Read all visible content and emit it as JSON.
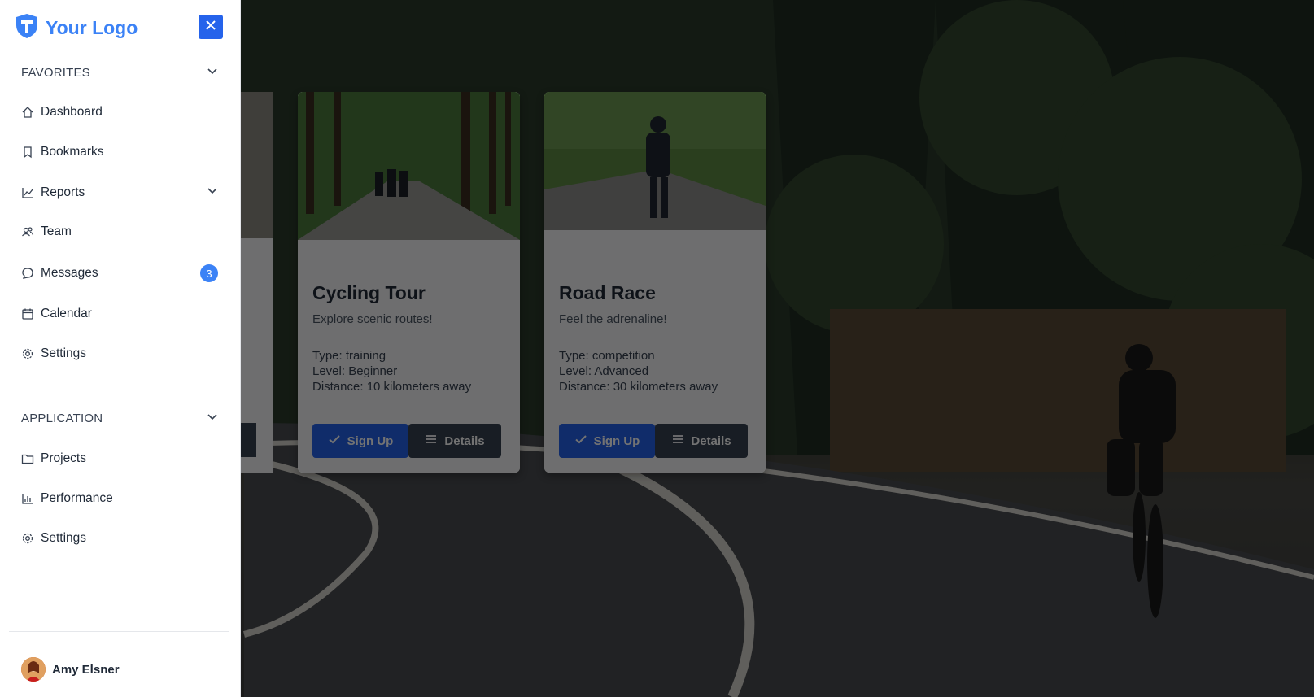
{
  "brand": {
    "logo_text": "Your Logo"
  },
  "sidebar": {
    "favorites_label": "FAVORITES",
    "favorites": [
      {
        "label": "Dashboard",
        "icon": "home-icon"
      },
      {
        "label": "Bookmarks",
        "icon": "bookmark-icon"
      },
      {
        "label": "Reports",
        "icon": "chart-line-icon",
        "expandable": true
      },
      {
        "label": "Team",
        "icon": "team-icon"
      },
      {
        "label": "Messages",
        "icon": "chat-icon",
        "badge": "3"
      },
      {
        "label": "Calendar",
        "icon": "calendar-icon"
      },
      {
        "label": "Settings",
        "icon": "gear-icon"
      }
    ],
    "application_label": "APPLICATION",
    "application": [
      {
        "label": "Projects",
        "icon": "folder-icon"
      },
      {
        "label": "Performance",
        "icon": "bar-chart-icon"
      },
      {
        "label": "Settings",
        "icon": "gear-icon"
      }
    ],
    "user": {
      "name": "Amy Elsner"
    }
  },
  "cards": [
    {
      "title": "Cycling Tour",
      "subtitle": "Explore scenic routes!",
      "type": "Type: training",
      "level": "Level: Beginner",
      "distance": "Distance: 10 kilometers away",
      "primary_label": "Sign Up",
      "secondary_label": "Details"
    },
    {
      "title": "Road Race",
      "subtitle": "Feel the adrenaline!",
      "type": "Type: competition",
      "level": "Level: Advanced",
      "distance": "Distance: 30 kilometers away",
      "primary_label": "Sign Up",
      "secondary_label": "Details"
    }
  ],
  "colors": {
    "accent": "#3b82f6",
    "button_primary": "#2563eb",
    "button_secondary": "#374151",
    "overlay": "rgba(0,0,0,0.55)"
  }
}
